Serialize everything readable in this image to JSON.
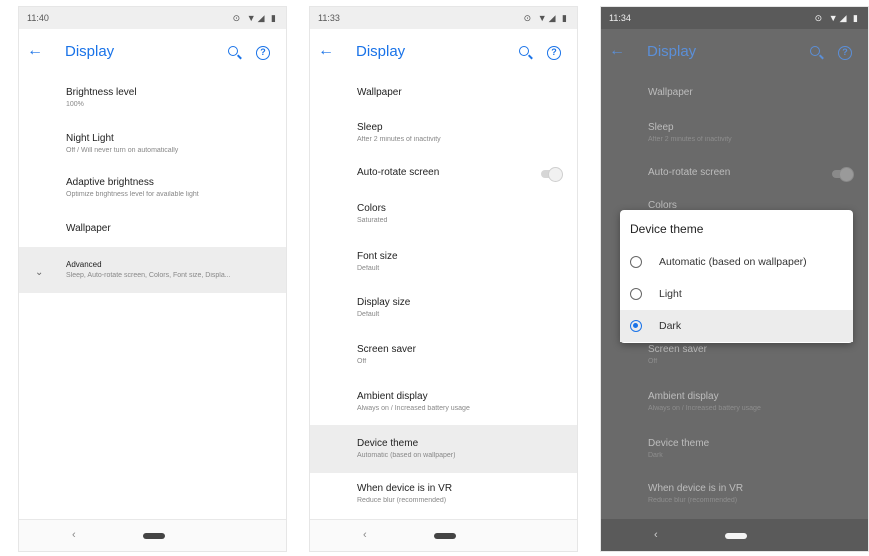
{
  "screens": [
    {
      "status_time": "11:40",
      "title": "Display",
      "items": [
        {
          "title": "Brightness level",
          "subtitle": "100%"
        },
        {
          "title": "Night Light",
          "subtitle": "Off / Will never turn on automatically"
        },
        {
          "title": "Adaptive brightness",
          "subtitle": "Optimize brightness level for available light"
        },
        {
          "title": "Wallpaper",
          "subtitle": ""
        },
        {
          "title": "Advanced",
          "subtitle": "Sleep, Auto-rotate screen, Colors, Font size, Displa..."
        }
      ]
    },
    {
      "status_time": "11:33",
      "title": "Display",
      "items": [
        {
          "title": "Wallpaper",
          "subtitle": ""
        },
        {
          "title": "Sleep",
          "subtitle": "After 2 minutes of inactivity"
        },
        {
          "title": "Auto-rotate screen",
          "subtitle": ""
        },
        {
          "title": "Colors",
          "subtitle": "Saturated"
        },
        {
          "title": "Font size",
          "subtitle": "Default"
        },
        {
          "title": "Display size",
          "subtitle": "Default"
        },
        {
          "title": "Screen saver",
          "subtitle": "Off"
        },
        {
          "title": "Ambient display",
          "subtitle": "Always on / Increased battery usage"
        },
        {
          "title": "Device theme",
          "subtitle": "Automatic (based on wallpaper)"
        },
        {
          "title": "When device is in VR",
          "subtitle": "Reduce blur (recommended)"
        }
      ]
    },
    {
      "status_time": "11:34",
      "title": "Display",
      "items": [
        {
          "title": "Wallpaper",
          "subtitle": ""
        },
        {
          "title": "Sleep",
          "subtitle": "After 2 minutes of inactivity"
        },
        {
          "title": "Auto-rotate screen",
          "subtitle": ""
        },
        {
          "title": "Colors",
          "subtitle": ""
        },
        {
          "title": "Screen saver",
          "subtitle": "Off"
        },
        {
          "title": "Ambient display",
          "subtitle": "Always on / Increased battery usage"
        },
        {
          "title": "Device theme",
          "subtitle": "Dark"
        },
        {
          "title": "When device is in VR",
          "subtitle": "Reduce blur (recommended)"
        }
      ],
      "dialog": {
        "title": "Device theme",
        "options": [
          "Automatic (based on wallpaper)",
          "Light",
          "Dark"
        ],
        "selected": "Dark"
      }
    }
  ],
  "icons": {
    "back": "arrow-back-icon",
    "search": "search-icon",
    "help": "help-icon",
    "nav_back": "nav-back-icon",
    "home": "home-pill-icon",
    "expand": "chevron-down-icon"
  },
  "glyphs": {
    "back": "←",
    "help": "?",
    "status_icons": "⊙ ▼◢ ▮",
    "nav_back": "‹",
    "chevron": "⌄"
  },
  "colors": {
    "accent": "#1a73e8",
    "highlight": "#ededed",
    "scrim": "#6a6a6a"
  }
}
